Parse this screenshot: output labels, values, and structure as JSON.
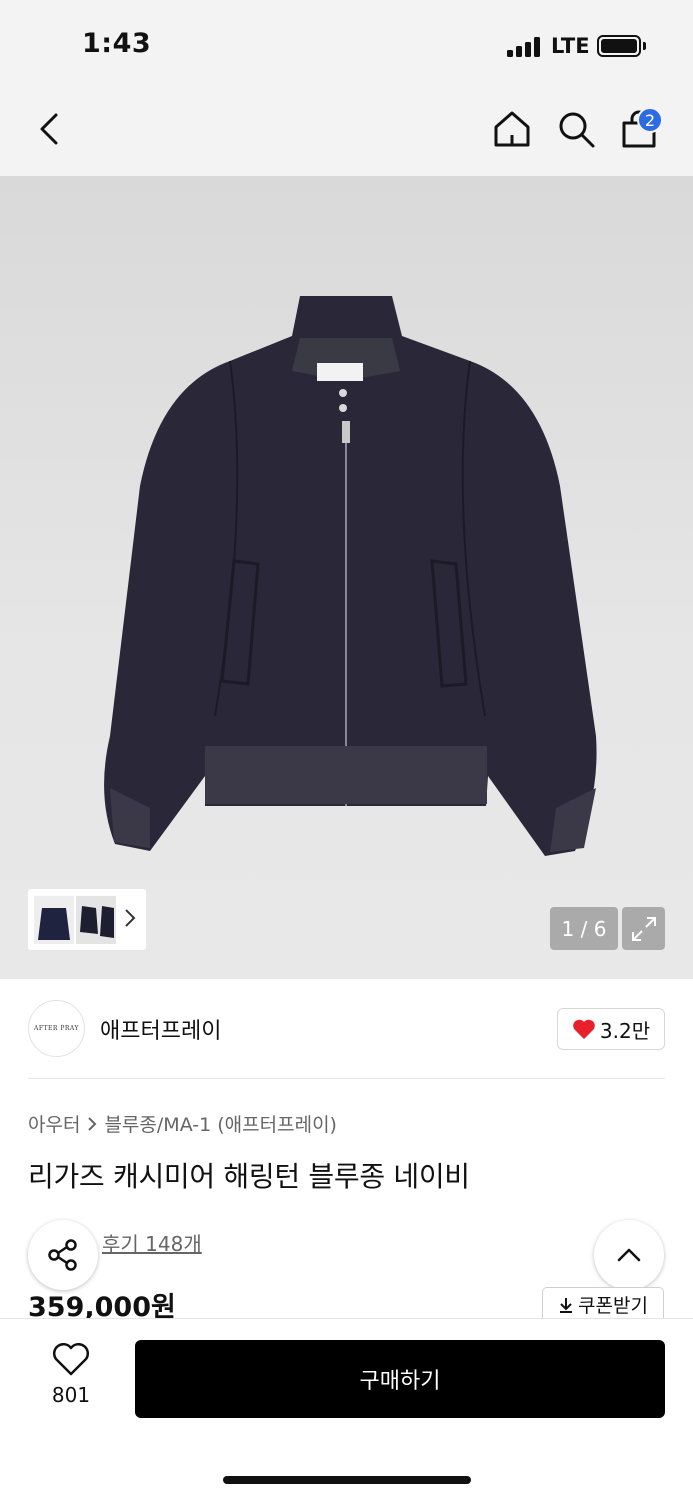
{
  "status_bar": {
    "time": "1:43",
    "network": "LTE"
  },
  "nav": {
    "back_icon": "chevron-left-icon",
    "home_icon": "home-icon",
    "search_icon": "search-icon",
    "cart_icon": "shopping-bag-icon",
    "cart_count": "2",
    "badge_color": "#2d6be4"
  },
  "gallery": {
    "counter": "1 / 6",
    "expand_icon": "expand-icon",
    "thumb_chevron_icon": "chevron-right-icon"
  },
  "brand": {
    "logo_text": "AFTER PRAY",
    "name": "애프터프레이",
    "likes": "3.2만",
    "heart_color": "#e8202a"
  },
  "breadcrumb": {
    "category": "아우터",
    "subcategory": "블루종/MA-1 (애프터프레이)"
  },
  "product": {
    "title": "리가즈 캐시미어 해링턴 블루종 네이비",
    "reviews": "후기 148개",
    "price": "359,000원",
    "coupon": "쿠폰받기"
  },
  "bottom_bar": {
    "wish_count": "801",
    "buy_label": "구매하기"
  }
}
